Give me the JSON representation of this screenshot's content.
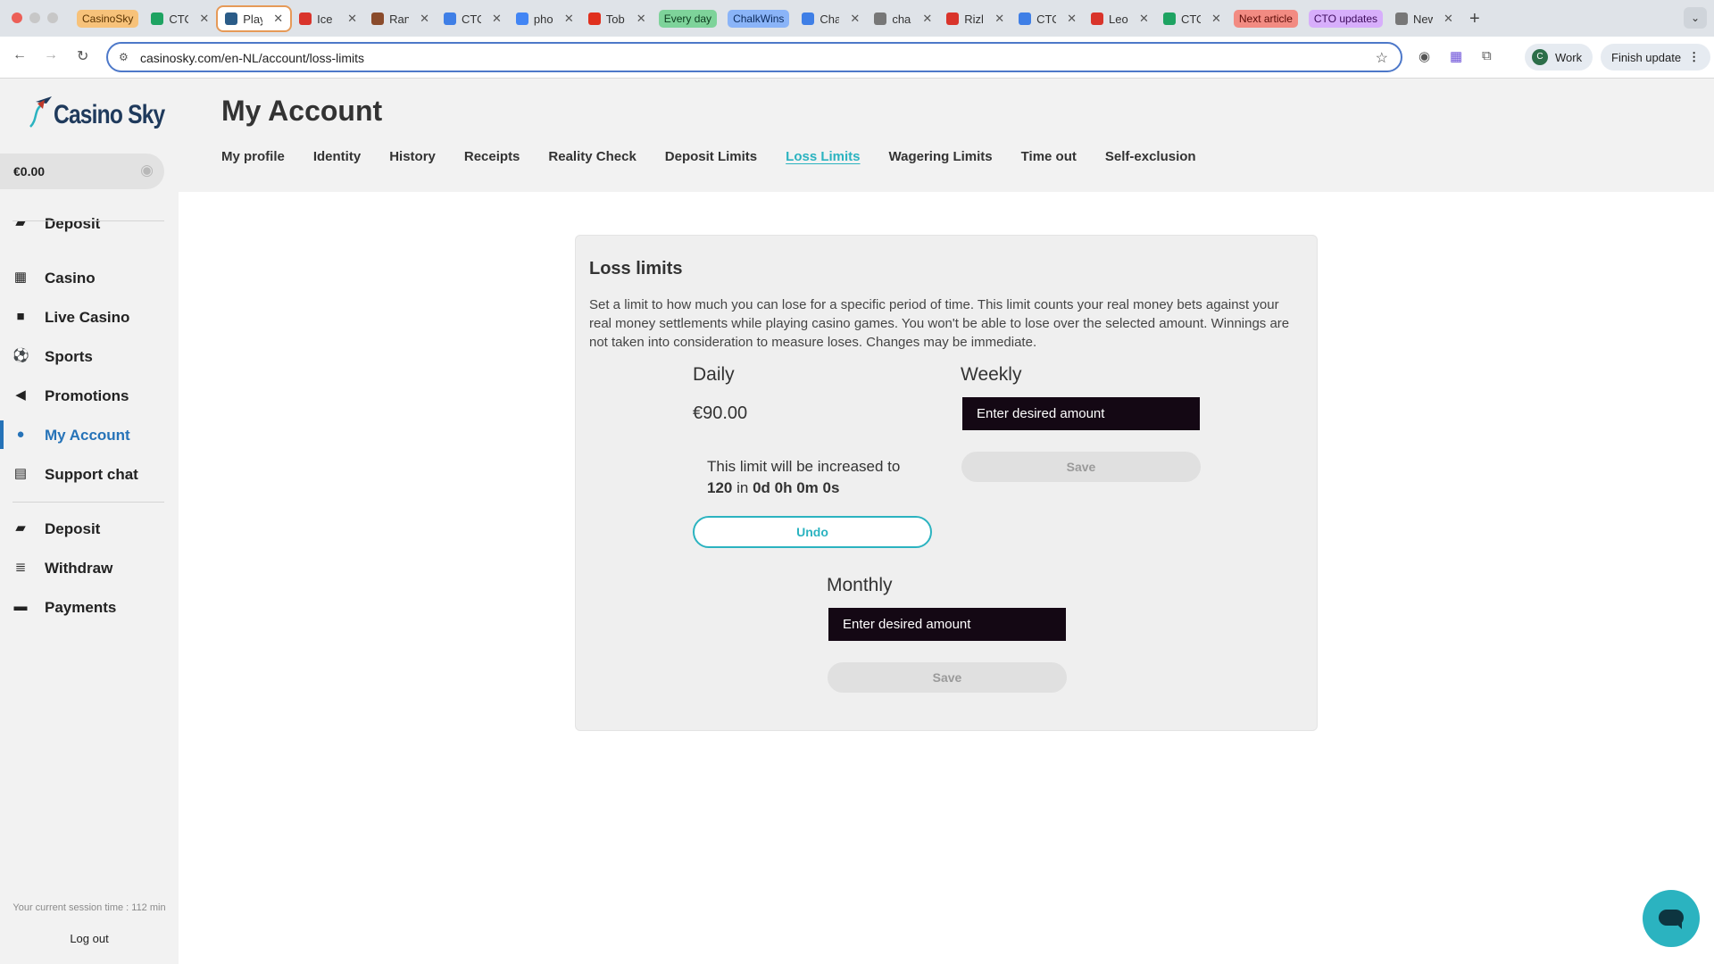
{
  "browser": {
    "tabs": [
      {
        "type": "group",
        "label": "CasinoSky",
        "bg": "#f7c27a",
        "color": "#5a3300"
      },
      {
        "type": "tab",
        "title": "CTO",
        "favicon_color": "#1ea362"
      },
      {
        "type": "tab",
        "title": "Play",
        "favicon_color": "#2b5c88",
        "active": true
      },
      {
        "type": "tab",
        "title": "Ice",
        "favicon_color": "#d9342b"
      },
      {
        "type": "tab",
        "title": "Ran",
        "favicon_color": "#8a4b2b"
      },
      {
        "type": "tab",
        "title": "CTO",
        "favicon_color": "#3f7fe6"
      },
      {
        "type": "tab",
        "title": "pho",
        "favicon_color": "#4285f4"
      },
      {
        "type": "tab",
        "title": "Tob",
        "favicon_color": "#e0301e"
      },
      {
        "type": "group",
        "label": "Every day",
        "bg": "#7ed39a",
        "color": "#0c3b1e"
      },
      {
        "type": "group",
        "label": "ChalkWins",
        "bg": "#8ab4f8",
        "color": "#0b2a5c"
      },
      {
        "type": "tab",
        "title": "Cha",
        "favicon_color": "#3f7fe6"
      },
      {
        "type": "tab",
        "title": "cha",
        "favicon_color": "#777777"
      },
      {
        "type": "tab",
        "title": "Rizl",
        "favicon_color": "#d9342b"
      },
      {
        "type": "tab",
        "title": "CTO",
        "favicon_color": "#3f7fe6"
      },
      {
        "type": "tab",
        "title": "Leo",
        "favicon_color": "#d9342b"
      },
      {
        "type": "tab",
        "title": "CTO",
        "favicon_color": "#1ea362"
      },
      {
        "type": "group",
        "label": "Next article",
        "bg": "#f28b82",
        "color": "#5c0b07"
      },
      {
        "type": "group",
        "label": "CTO updates",
        "bg": "#d7aefb",
        "color": "#3d0b5c"
      },
      {
        "type": "tab",
        "title": "New",
        "favicon_color": "#777777"
      }
    ],
    "url": "casinosky.com/en-NL/account/loss-limits",
    "profile_initial": "C",
    "profile_label": "Work",
    "update_label": "Finish update"
  },
  "sidebar": {
    "logo_text": "Casino Sky",
    "balance": "€0.00",
    "items_primary": [
      {
        "label": "Deposit",
        "icon": "wallet-icon"
      }
    ],
    "items_nav": [
      {
        "label": "Casino",
        "icon": "grid-icon"
      },
      {
        "label": "Live Casino",
        "icon": "video-camera-icon"
      },
      {
        "label": "Sports",
        "icon": "soccer-ball-icon"
      },
      {
        "label": "Promotions",
        "icon": "megaphone-icon"
      },
      {
        "label": "My Account",
        "icon": "user-circle-icon",
        "active": true
      },
      {
        "label": "Support chat",
        "icon": "chat-icon"
      }
    ],
    "items_payments": [
      {
        "label": "Deposit",
        "icon": "wallet-icon"
      },
      {
        "label": "Withdraw",
        "icon": "coins-icon"
      },
      {
        "label": "Payments",
        "icon": "card-icon"
      }
    ],
    "session_text": "Your current session time : 112 min",
    "logout_label": "Log out"
  },
  "main": {
    "title": "My Account",
    "tabs": [
      {
        "label": "My profile"
      },
      {
        "label": "Identity"
      },
      {
        "label": "History"
      },
      {
        "label": "Receipts"
      },
      {
        "label": "Reality Check"
      },
      {
        "label": "Deposit Limits"
      },
      {
        "label": "Loss Limits",
        "active": true
      },
      {
        "label": "Wagering Limits"
      },
      {
        "label": "Time out"
      },
      {
        "label": "Self-exclusion"
      }
    ]
  },
  "loss_limits": {
    "heading": "Loss limits",
    "description": "Set a limit to how much you can lose for a specific period of time. This limit counts your real money bets against your real money settlements while playing casino games. You won't be able to lose over the selected amount. Winnings are not taken into consideration to measure loses. Changes may be immediate.",
    "daily": {
      "title": "Daily",
      "current": "€90.00",
      "notice_prefix": "This limit will be increased to",
      "new_value": "120",
      "notice_mid": "in",
      "countdown": "0d 0h 0m 0s",
      "undo_label": "Undo"
    },
    "weekly": {
      "title": "Weekly",
      "placeholder": "Enter desired amount",
      "save_label": "Save"
    },
    "monthly": {
      "title": "Monthly",
      "placeholder": "Enter desired amount",
      "save_label": "Save"
    }
  }
}
